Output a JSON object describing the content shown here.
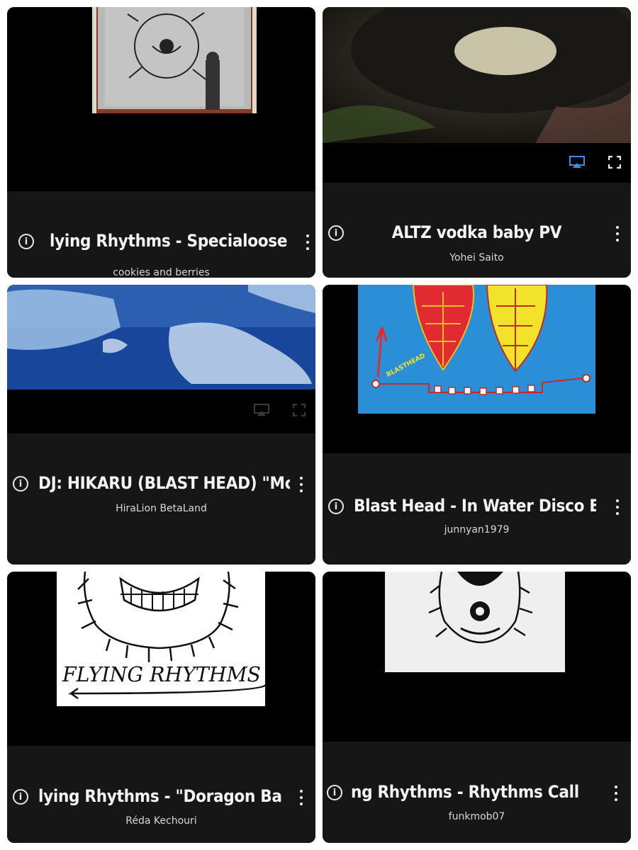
{
  "videos": [
    {
      "title": "lying Rhythms - Specialoose",
      "channel": "cookies and berries"
    },
    {
      "title": "ALTZ vodka baby PV",
      "channel": "Yohei Saito"
    },
    {
      "title": "DJ: HIKARU (BLAST HEAD) \"Mc",
      "channel": "HiraLion BetaLand"
    },
    {
      "title": "Blast Head - In Water Disco E",
      "channel": "junnyan1979"
    },
    {
      "title": "lying Rhythms - \"Doragon Ba",
      "channel": "Réda Kechouri"
    },
    {
      "title": "ng Rhythms - Rhythms Call",
      "channel": "funkmob07"
    }
  ],
  "artwork": {
    "flying_rhythms_text": "FLYING RHYTHMS",
    "blasthead_text": "BLASTHEAD"
  },
  "icons": {
    "info": "info-icon",
    "more": "more-vert-icon",
    "airplay": "airplay-icon",
    "fullscreen": "fullscreen-icon"
  },
  "colors": {
    "tile_bg": "#000000",
    "info_bar": "#161616",
    "airplay_active": "#3b8ee8",
    "album_blue": "#2a8fd6"
  }
}
